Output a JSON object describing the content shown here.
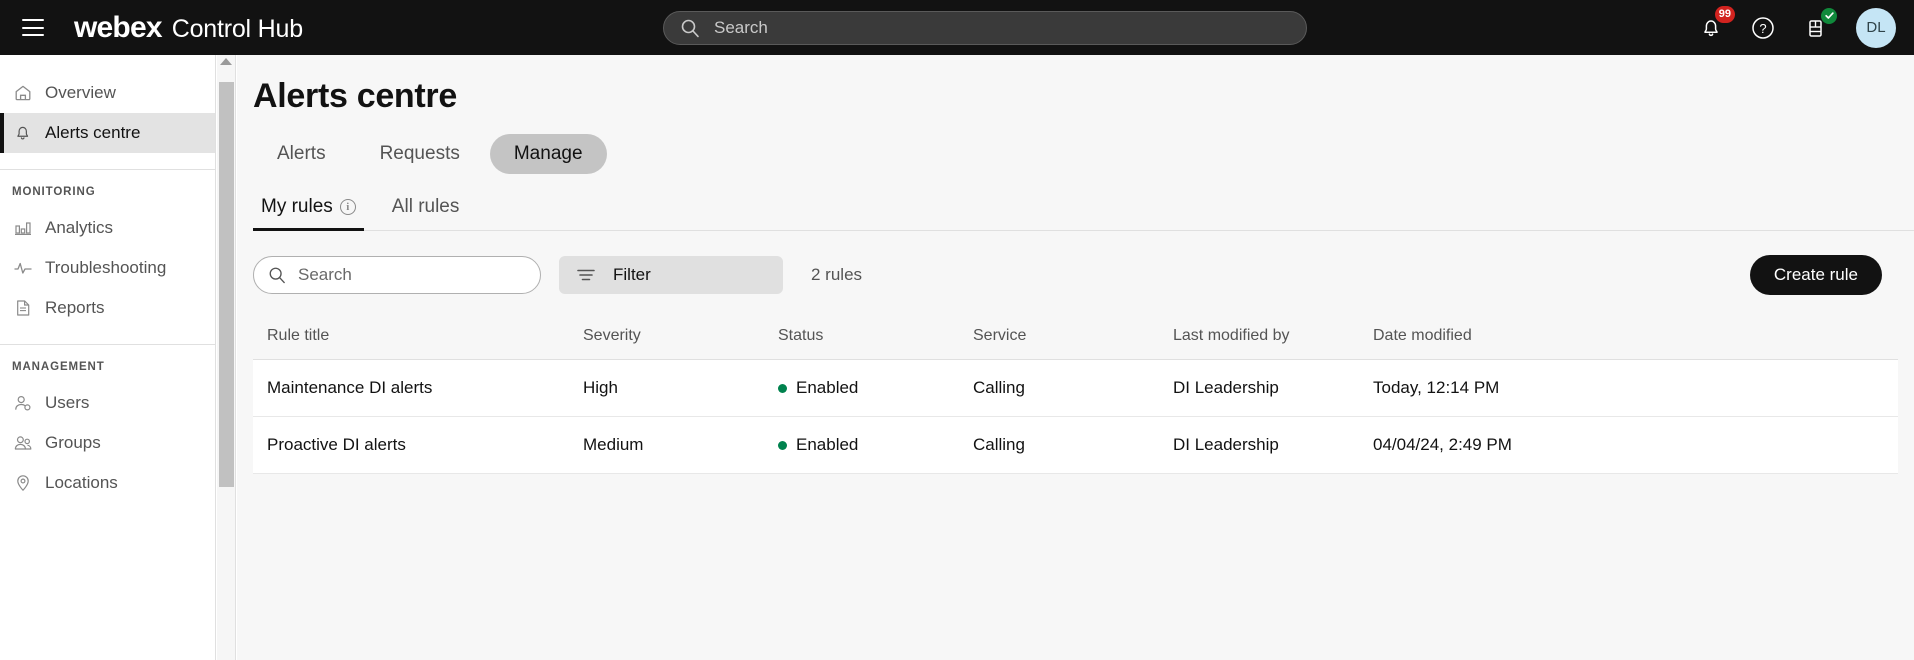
{
  "topbar": {
    "menu_icon": "hamburger-icon",
    "brand_primary": "webex",
    "brand_secondary": "Control Hub",
    "search_placeholder": "Search",
    "search_value": "",
    "notifications_badge": "99",
    "help_icon": "question-mark-icon",
    "tasks_icon": "document-check-icon",
    "avatar_initials": "DL"
  },
  "sidebar": {
    "primary_items": [
      {
        "label": "Overview",
        "icon": "home-icon",
        "active": false
      },
      {
        "label": "Alerts centre",
        "icon": "bell-icon",
        "active": true
      }
    ],
    "groups": [
      {
        "title": "MONITORING",
        "items": [
          {
            "label": "Analytics",
            "icon": "bar-chart-icon"
          },
          {
            "label": "Troubleshooting",
            "icon": "pulse-icon"
          },
          {
            "label": "Reports",
            "icon": "report-document-icon"
          }
        ]
      },
      {
        "title": "MANAGEMENT",
        "items": [
          {
            "label": "Users",
            "icon": "user-gear-icon"
          },
          {
            "label": "Groups",
            "icon": "users-icon"
          },
          {
            "label": "Locations",
            "icon": "map-pin-icon"
          }
        ]
      }
    ]
  },
  "main": {
    "page_title": "Alerts centre",
    "tabs": [
      {
        "label": "Alerts",
        "selected": false
      },
      {
        "label": "Requests",
        "selected": false
      },
      {
        "label": "Manage",
        "selected": true
      }
    ],
    "subtabs": [
      {
        "label": "My rules",
        "active": true,
        "has_info_icon": true,
        "info_glyph": "i"
      },
      {
        "label": "All rules",
        "active": false,
        "has_info_icon": false
      }
    ],
    "toolbar": {
      "search_placeholder": "Search",
      "search_value": "",
      "filter_label": "Filter",
      "rules_count": "2 rules",
      "create_label": "Create rule"
    },
    "table": {
      "columns": [
        "Rule title",
        "Severity",
        "Status",
        "Service",
        "Last modified by",
        "Date modified"
      ],
      "rows": [
        {
          "rule_title": "Maintenance DI alerts",
          "severity": "High",
          "status": "Enabled",
          "service": "Calling",
          "last_modified_by": "DI Leadership",
          "date_modified": "Today, 12:14 PM"
        },
        {
          "rule_title": "Proactive DI alerts",
          "severity": "Medium",
          "status": "Enabled",
          "service": "Calling",
          "last_modified_by": "DI Leadership",
          "date_modified": "04/04/24, 2:49 PM"
        }
      ]
    }
  },
  "colors": {
    "topbar_bg": "#121212",
    "accent_dark": "#121212",
    "status_enabled": "#00824e",
    "badge_red": "#d2231f",
    "badge_green": "#10893b",
    "avatar_bg": "#c5e5f5",
    "active_nav_bg": "#e3e3e3",
    "page_bg": "#f7f7f7"
  }
}
